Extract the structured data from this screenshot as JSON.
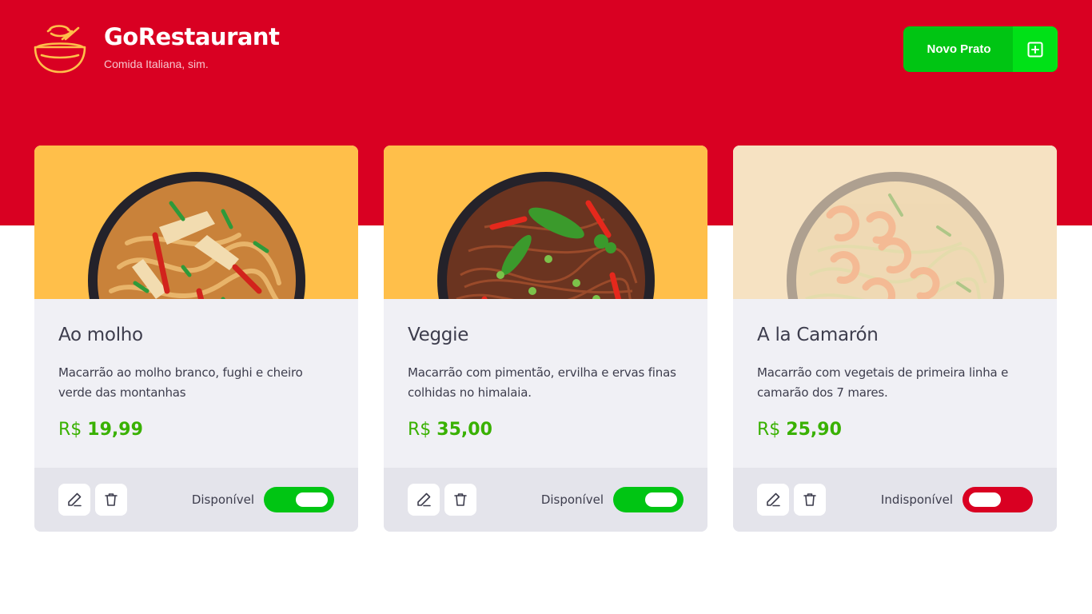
{
  "header": {
    "title": "GoRestaurant",
    "subtitle": "Comida Italiana, sim.",
    "logo_icon": "bowl-logo-icon",
    "new_button_label": "Novo Prato",
    "new_button_icon": "plus-square-icon"
  },
  "colors": {
    "brand_red": "#d90022",
    "accent_green": "#00c513",
    "card_image_bg": "#ffbf4a",
    "card_bg": "#f0f0f5",
    "card_footer_bg": "#e4e4eb",
    "price_green": "#39b100"
  },
  "dishes": [
    {
      "name": "Ao molho",
      "description": "Macarrão ao molho branco, fughi e cheiro verde das montanhas",
      "currency": "R$",
      "price": "19,99",
      "available": true,
      "availability_label": "Disponível",
      "edit_icon": "pencil-icon",
      "delete_icon": "trash-icon"
    },
    {
      "name": "Veggie",
      "description": "Macarrão com pimentão, ervilha e ervas finas colhidas no himalaia.",
      "currency": "R$",
      "price": "35,00",
      "available": true,
      "availability_label": "Disponível",
      "edit_icon": "pencil-icon",
      "delete_icon": "trash-icon"
    },
    {
      "name": "A la Camarón",
      "description": "Macarrão com vegetais de primeira linha e camarão dos 7 mares.",
      "currency": "R$",
      "price": "25,90",
      "available": false,
      "availability_label": "Indisponível",
      "edit_icon": "pencil-icon",
      "delete_icon": "trash-icon"
    }
  ]
}
